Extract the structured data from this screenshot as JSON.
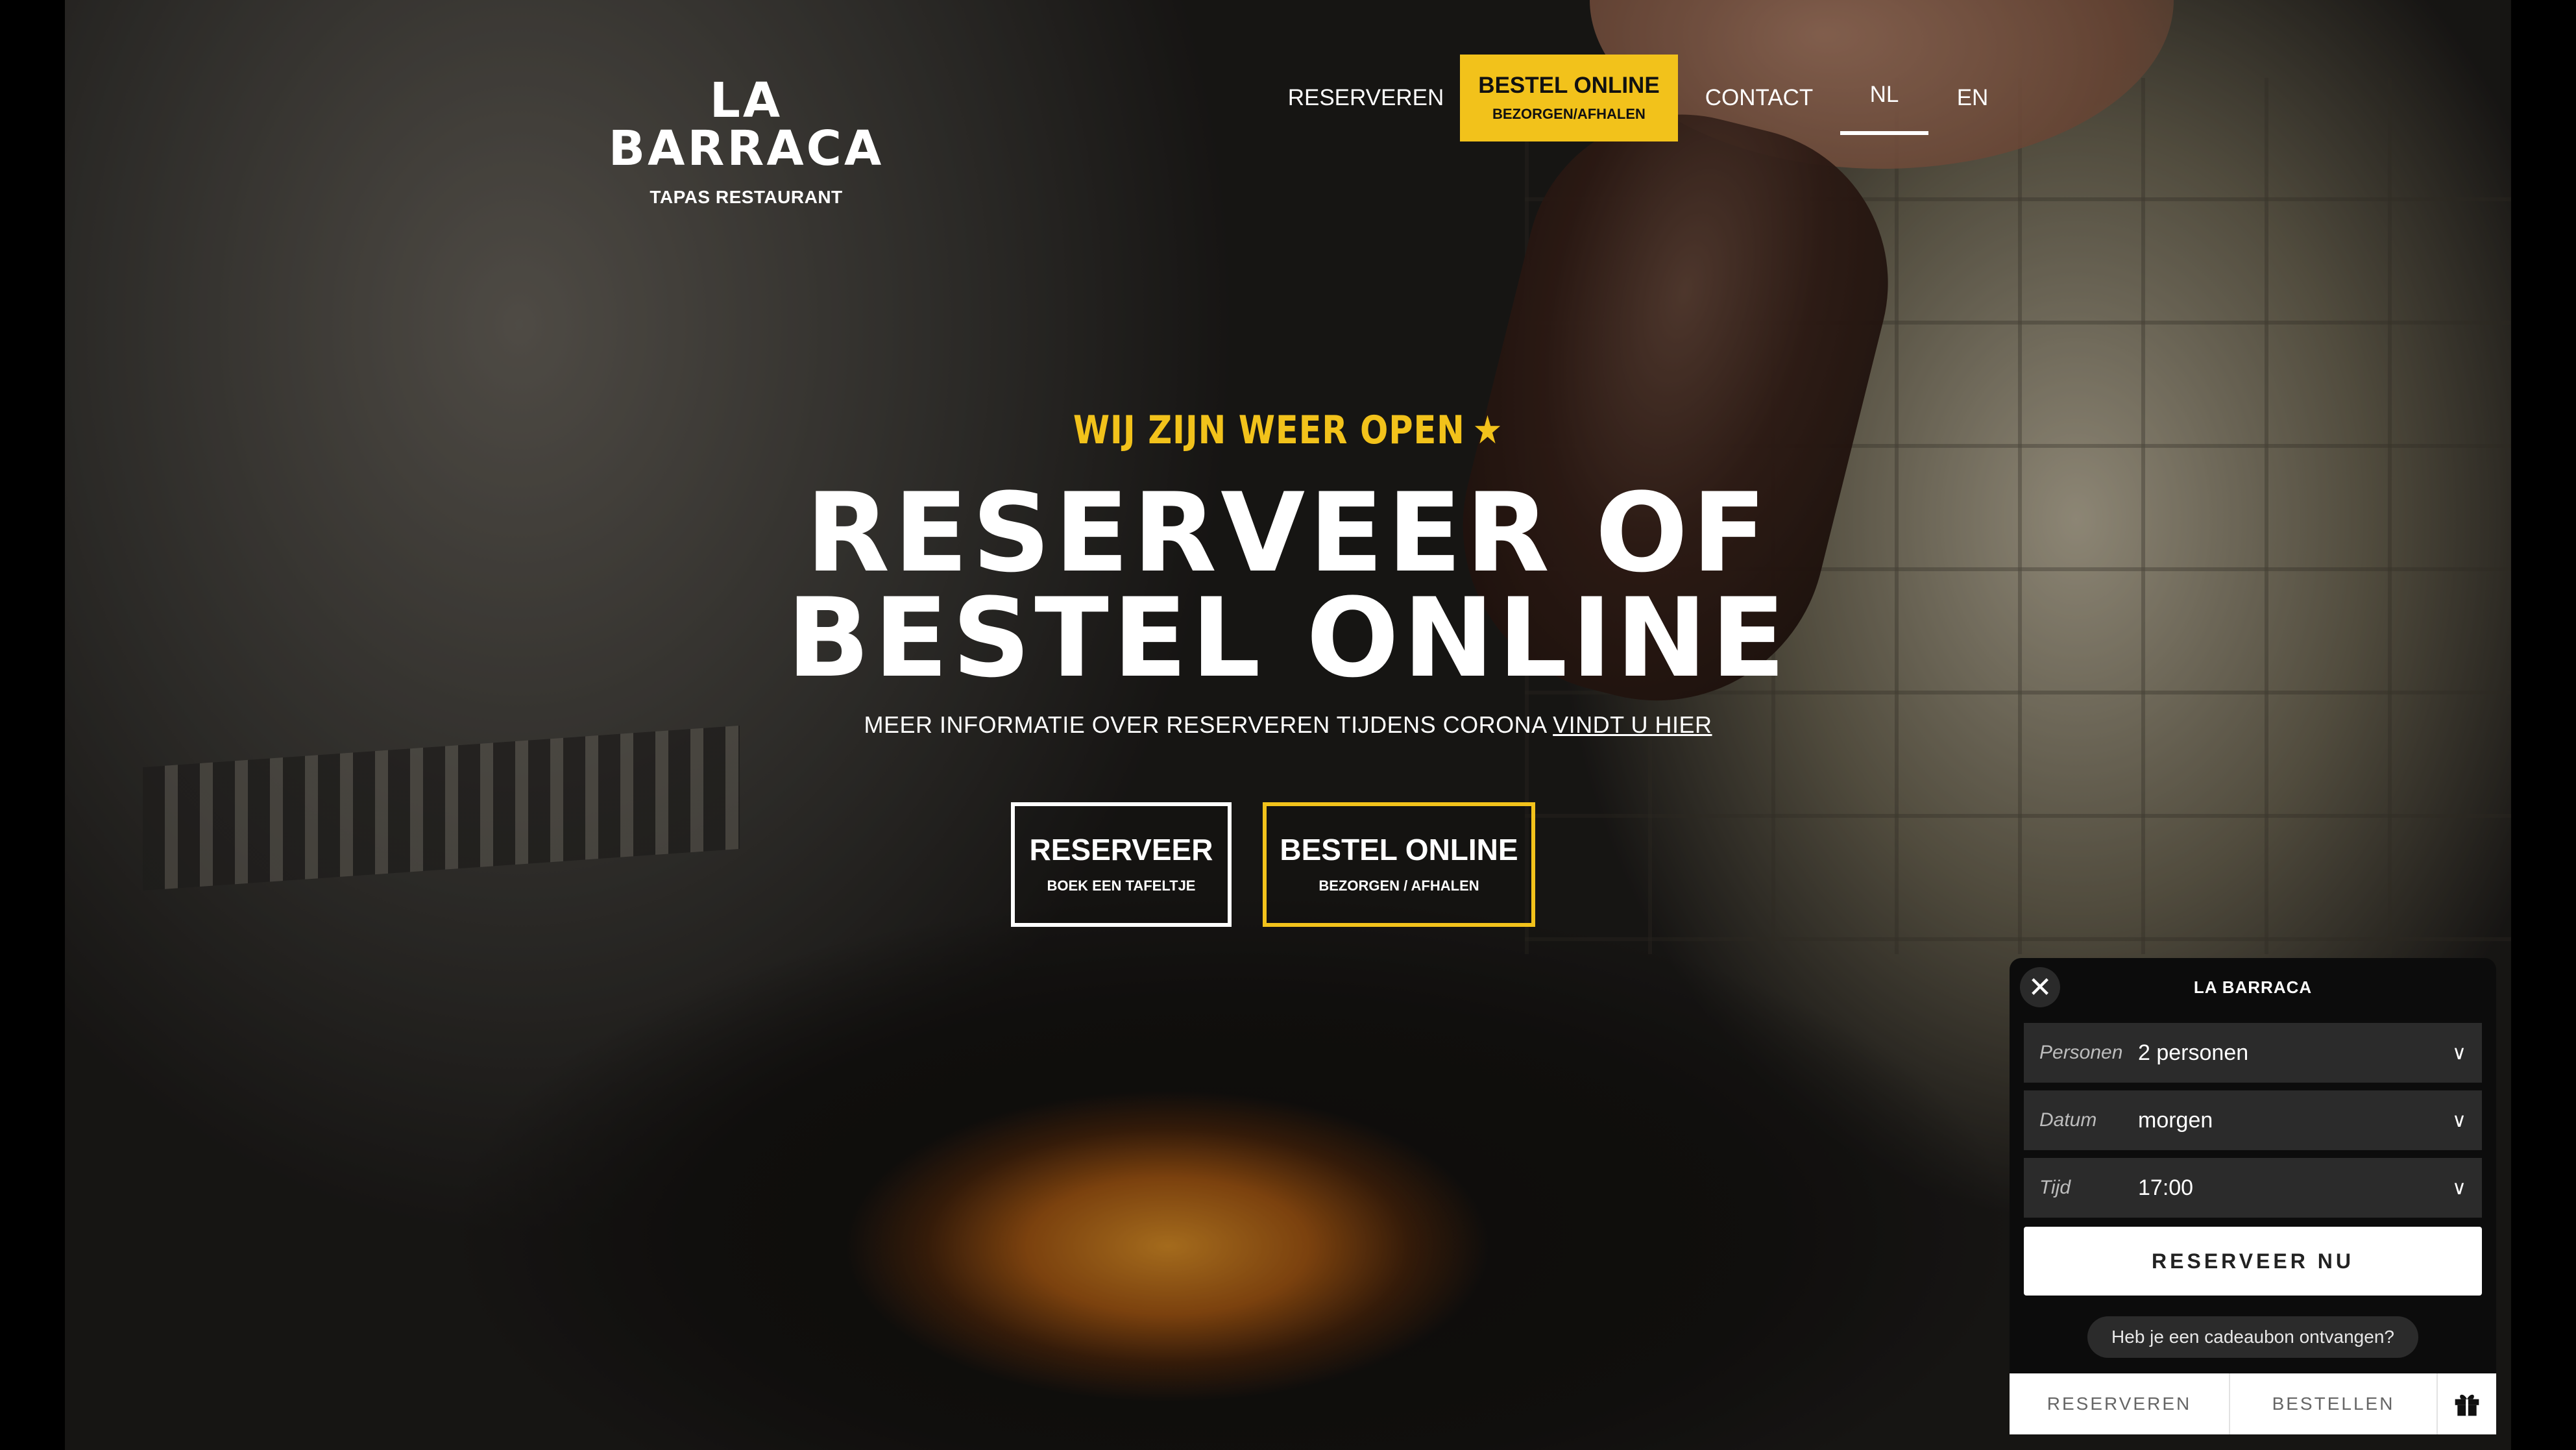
{
  "brand": {
    "title": "LA BARRACA",
    "subtitle": "TAPAS RESTAURANT"
  },
  "nav": {
    "reserveren": "RESERVEREN",
    "bestel_line1": "BESTEL ONLINE",
    "bestel_line2": "BEZORGEN/AFHALEN",
    "contact": "CONTACT",
    "lang_nl": "NL",
    "lang_en": "EN",
    "active_language": "NL",
    "accent_color": "#f2c21b"
  },
  "hero": {
    "announcement": "WIJ ZIJN WEER OPEN",
    "announcement_icon": "party-popper-icon",
    "headline_line1": "RESERVEER OF",
    "headline_line2": "BESTEL ONLINE",
    "info_text": "MEER INFORMATIE OVER RESERVEREN TIJDENS CORONA",
    "info_link": "VINDT U HIER"
  },
  "cta": {
    "reserveer_title": "RESERVEER",
    "reserveer_sub": "BOEK EEN TAFELTJE",
    "bestel_title": "BESTEL ONLINE",
    "bestel_sub": "BEZORGEN / AFHALEN"
  },
  "widget": {
    "title": "LA BARRACA",
    "close_icon": "close-icon",
    "fields": [
      {
        "label": "Personen",
        "value": "2 personen"
      },
      {
        "label": "Datum",
        "value": "morgen"
      },
      {
        "label": "Tijd",
        "value": "17:00"
      }
    ],
    "submit": "RESERVEER NU",
    "gift_question": "Heb je een cadeaubon ontvangen?",
    "tabs": {
      "reserveren": "RESERVEREN",
      "bestellen": "BESTELLEN",
      "gift_icon": "gift-icon"
    }
  }
}
